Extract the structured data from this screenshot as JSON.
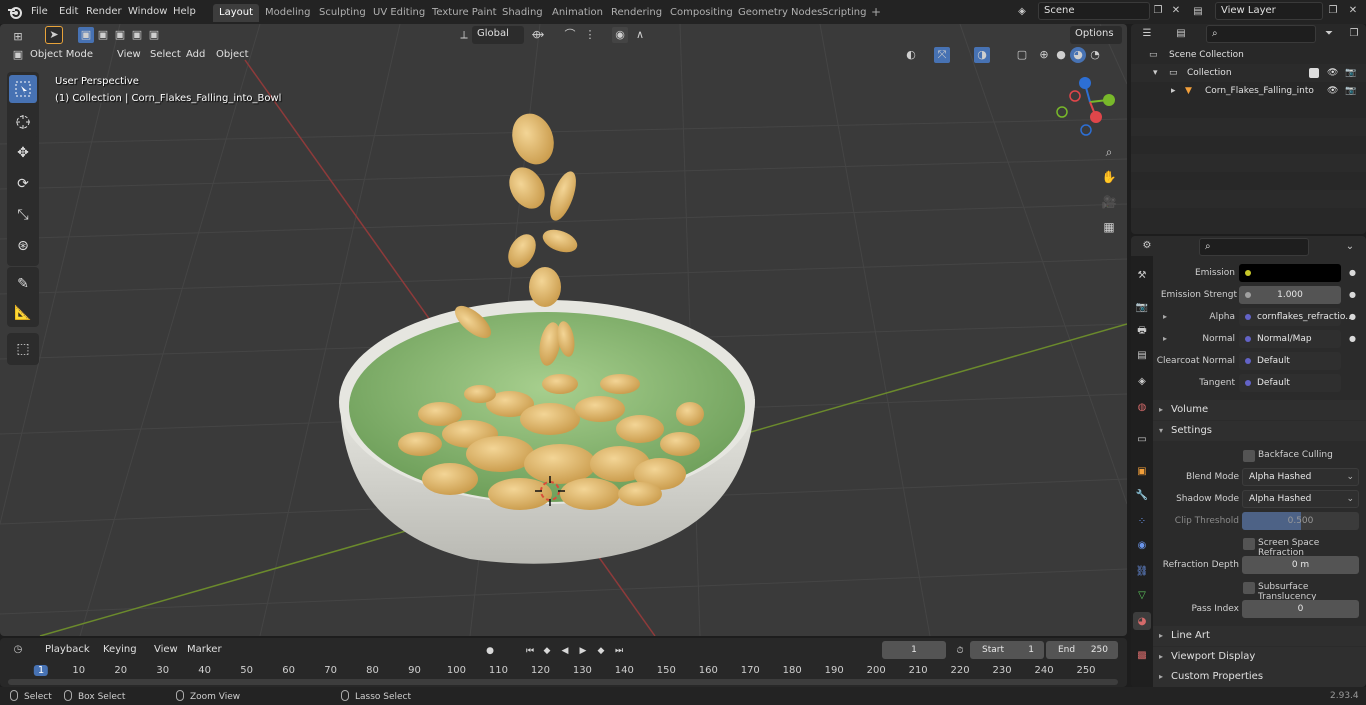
{
  "menu": [
    "File",
    "Edit",
    "Render",
    "Window",
    "Help"
  ],
  "workspace_tabs": [
    "Layout",
    "Modeling",
    "Sculpting",
    "UV Editing",
    "Texture Paint",
    "Shading",
    "Animation",
    "Rendering",
    "Compositing",
    "Geometry Nodes",
    "Scripting"
  ],
  "active_workspace": "Layout",
  "scene_name": "Scene",
  "view_layer_name": "View Layer",
  "viewport": {
    "mode": "Object Mode",
    "menus": [
      "View",
      "Select",
      "Add",
      "Object"
    ],
    "transform_orientation": "Global",
    "options_label": "Options",
    "perspective_label": "User Perspective",
    "collection_info": "(1) Collection | Corn_Flakes_Falling_into_Bowl",
    "gizmo": {
      "x": "X",
      "y": "Y",
      "z": "Z"
    }
  },
  "outliner": {
    "root": "Scene Collection",
    "collection": "Collection",
    "object": "Corn_Flakes_Falling_into"
  },
  "properties": {
    "rows": [
      {
        "label": "Emission",
        "value": "",
        "socket_color": "#c7c729"
      },
      {
        "label": "Emission Strengt",
        "value": "1.000",
        "socket_color": "#a1a1a1"
      },
      {
        "label": "Alpha",
        "value": "cornflakes_refractio...",
        "socket_color": "#6363c7"
      },
      {
        "label": "Normal",
        "value": "Normal/Map",
        "socket_color": "#6363c7"
      },
      {
        "label": "Clearcoat Normal",
        "value": "Default",
        "socket_color": "#6363c7"
      },
      {
        "label": "Tangent",
        "value": "Default",
        "socket_color": "#6363c7"
      }
    ],
    "panels": {
      "volume": "Volume",
      "settings": "Settings",
      "line_art": "Line Art",
      "viewport_display": "Viewport Display",
      "custom_properties": "Custom Properties"
    },
    "backface_culling": "Backface Culling",
    "blend_mode_label": "Blend Mode",
    "blend_mode_value": "Alpha Hashed",
    "shadow_mode_label": "Shadow Mode",
    "shadow_mode_value": "Alpha Hashed",
    "clip_threshold_label": "Clip Threshold",
    "clip_threshold_value": "0.500",
    "clip_threshold_fraction": 0.5,
    "screen_space_refraction": "Screen Space Refraction",
    "refraction_depth_label": "Refraction Depth",
    "refraction_depth_value": "0 m",
    "subsurface_translucency": "Subsurface Translucency",
    "pass_index_label": "Pass Index",
    "pass_index_value": "0"
  },
  "timeline": {
    "menus": [
      "Playback",
      "Keying",
      "View",
      "Marker"
    ],
    "current_frame": "1",
    "start_label": "Start",
    "start_value": "1",
    "end_label": "End",
    "end_value": "250",
    "ticks": [
      "1",
      "10",
      "20",
      "30",
      "40",
      "50",
      "60",
      "70",
      "80",
      "90",
      "100",
      "110",
      "120",
      "130",
      "140",
      "150",
      "160",
      "170",
      "180",
      "190",
      "200",
      "210",
      "220",
      "230",
      "240",
      "250"
    ]
  },
  "statusbar": {
    "select": "Select",
    "box_select": "Box Select",
    "zoom_view": "Zoom View",
    "lasso_select": "Lasso Select",
    "version": "2.93.4"
  }
}
